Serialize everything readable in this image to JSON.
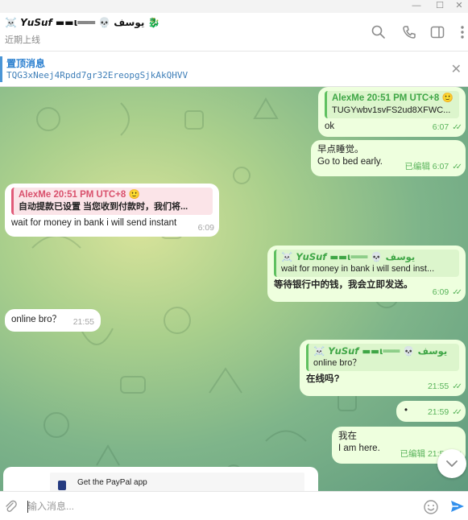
{
  "window": {
    "minimize_icon": "minimize-icon",
    "maximize_icon": "maximize-icon",
    "close_icon": "close-icon"
  },
  "header": {
    "chat_name": "☠️ 𝙔𝙪𝙎𝙪𝙛 ▬▬ι═══ 💀 يوسف 🐉",
    "status": "近期上线",
    "icons": [
      "search-icon",
      "phone-icon",
      "sidebar-icon",
      "more-vertical-icon"
    ]
  },
  "pinned": {
    "title": "置顶消息",
    "text": "TQG3xNeej4Rpdd7gr32EreopgSjkAkQHVV"
  },
  "messages": [
    {
      "id": "m1",
      "direction": "out",
      "reply_name": "AlexMe 20:51 PM UTC+8 🙂",
      "reply_text": "TUGYwbv1svFS2ud8XFWC...",
      "text": "ok",
      "time": "6:07",
      "status": "read"
    },
    {
      "id": "m2",
      "direction": "out",
      "text_line1": "早点睡觉。",
      "text_line2": "Go to bed early.",
      "edited": "已编辑",
      "time": "6:07",
      "status": "read"
    },
    {
      "id": "m3",
      "direction": "in",
      "reply_name": "AlexMe 20:51 PM UTC+8 🙂",
      "reply_text": "自动提款已设置 当您收到付款时，我们将...",
      "text": "wait for money in bank i will send instant",
      "time": "6:09"
    },
    {
      "id": "m4",
      "direction": "out",
      "reply_name": "☠️ 𝙔𝙪𝙎𝙪𝙛 ▬▬ι═══ 💀 يوسف",
      "reply_text": "wait for money in bank i will send inst...",
      "text": "等待银行中的钱，我会立即发送。",
      "time": "6:09",
      "status": "read"
    },
    {
      "id": "m5",
      "direction": "in",
      "text": "online bro？",
      "time": "21:55"
    },
    {
      "id": "m6",
      "direction": "out",
      "reply_name": "☠️ 𝙔𝙪𝙎𝙪𝙛 ▬▬ι═══ 💀 يوسف",
      "reply_text": "online bro？",
      "text": "在线吗?",
      "time": "21:55",
      "status": "read"
    },
    {
      "id": "m7",
      "direction": "out",
      "text": "•",
      "time": "21:59",
      "status": "read"
    },
    {
      "id": "m8",
      "direction": "out",
      "text_line1": "我在",
      "text_line2": "I am here.",
      "edited": "已编辑",
      "time": "21:59",
      "status": "read"
    }
  ],
  "card": {
    "text": "Get the PayPal app"
  },
  "composer": {
    "placeholder": "输入消息...",
    "icons": [
      "attach-icon",
      "emoji-icon",
      "send-icon"
    ]
  },
  "colors": {
    "accent": "#2a7fcf",
    "outgoing_bubble": "#eeffde",
    "incoming_bubble": "#ffffff",
    "read_check": "#58b35a",
    "send": "#3390ec"
  }
}
